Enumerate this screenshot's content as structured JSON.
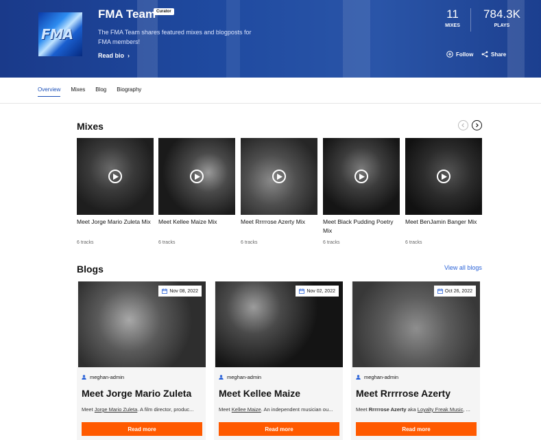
{
  "profile": {
    "title": "FMA Team",
    "badge": "Curator",
    "avatar_text": "FMA",
    "description": "The FMA Team shares featured mixes and blogposts for FMA members!",
    "read_bio": "Read bio"
  },
  "stats": {
    "mixes_count": "11",
    "mixes_label": "MIXES",
    "plays_count": "784.3K",
    "plays_label": "PLAYS"
  },
  "actions": {
    "follow": "Follow",
    "share": "Share"
  },
  "tabs": [
    {
      "label": "Overview",
      "active": true
    },
    {
      "label": "Mixes",
      "active": false
    },
    {
      "label": "Blog",
      "active": false
    },
    {
      "label": "Biography",
      "active": false
    }
  ],
  "mixes": {
    "title": "Mixes",
    "items": [
      {
        "name": "Meet Jorge Mario Zuleta Mix",
        "tracks": "6 tracks"
      },
      {
        "name": "Meet Kellee Maize Mix",
        "tracks": "6 tracks"
      },
      {
        "name": "Meet Rrrrrose Azerty Mix",
        "tracks": "6 tracks"
      },
      {
        "name": "Meet Black Pudding Poetry Mix",
        "tracks": "6 tracks"
      },
      {
        "name": "Meet BenJamin Banger Mix",
        "tracks": "6 tracks"
      }
    ]
  },
  "blogs": {
    "title": "Blogs",
    "view_all": "View all blogs",
    "items": [
      {
        "date": "Nov 08, 2022",
        "author": "meghan-admin",
        "title": "Meet Jorge Mario Zuleta",
        "ex_pre": "Meet ",
        "ex_link": "Jorge Mario Zuleta",
        "ex_post": ". A film director, produc...",
        "read_more": "Read more"
      },
      {
        "date": "Nov 02, 2022",
        "author": "meghan-admin",
        "title": "Meet Kellee Maize",
        "ex_pre": "Meet ",
        "ex_link": "Kellee Maize",
        "ex_post": ". An independent musician ou...",
        "read_more": "Read more"
      },
      {
        "date": "Oct 26, 2022",
        "author": "meghan-admin",
        "title": "Meet Rrrrrose Azerty",
        "ex_pre": "Meet ",
        "ex_bold": "Rrrrrose Azerty",
        "ex_mid": " aka ",
        "ex_link": "Loyalty Freak Music",
        "ex_post": ", ...",
        "read_more": "Read more"
      }
    ]
  },
  "colors": {
    "accent": "#1a4fb8",
    "read_more": "#ff5a00",
    "hero": "#1f4aa0"
  }
}
